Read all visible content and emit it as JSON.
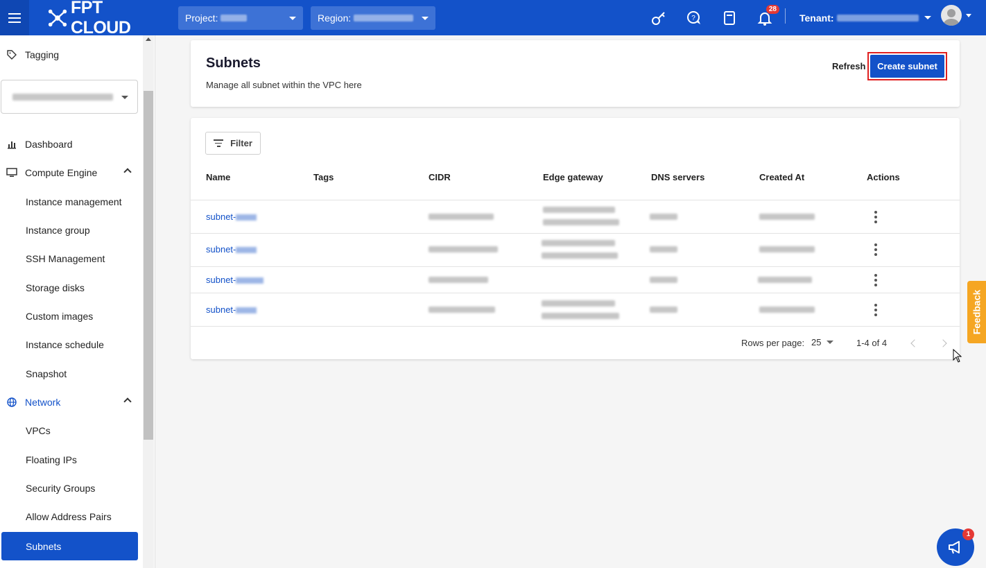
{
  "topbar": {
    "logo_text": "FPT CLOUD",
    "project_label": "Project:",
    "region_label": "Region:",
    "notification_count": "28",
    "tenant_label": "Tenant:"
  },
  "sidebar": {
    "tagging": "Tagging",
    "dashboard": "Dashboard",
    "compute_engine": "Compute Engine",
    "compute_items": [
      "Instance management",
      "Instance group",
      "SSH Management",
      "Storage disks",
      "Custom images",
      "Instance schedule",
      "Snapshot"
    ],
    "network": "Network",
    "network_items": [
      "VPCs",
      "Floating IPs",
      "Security Groups",
      "Allow Address Pairs",
      "Subnets"
    ]
  },
  "header": {
    "title": "Subnets",
    "subtitle": "Manage all subnet within the VPC here",
    "refresh_label": "Refresh",
    "create_label": "Create subnet"
  },
  "table": {
    "filter_label": "Filter",
    "columns": [
      "Name",
      "Tags",
      "CIDR",
      "Edge gateway",
      "DNS servers",
      "Created At",
      "Actions"
    ],
    "rows": [
      {
        "name_prefix": "subnet-"
      },
      {
        "name_prefix": "subnet-"
      },
      {
        "name_prefix": "subnet-"
      },
      {
        "name_prefix": "subnet-"
      }
    ],
    "rows_per_page_label": "Rows per page:",
    "rows_per_page_value": "25",
    "range": "1-4 of 4"
  },
  "feedback_label": "Feedback",
  "announcement_count": "1",
  "colors": {
    "primary": "#1352c9",
    "feedback": "#f5a623",
    "highlight_border": "#e02020",
    "badge": "#e53935"
  }
}
